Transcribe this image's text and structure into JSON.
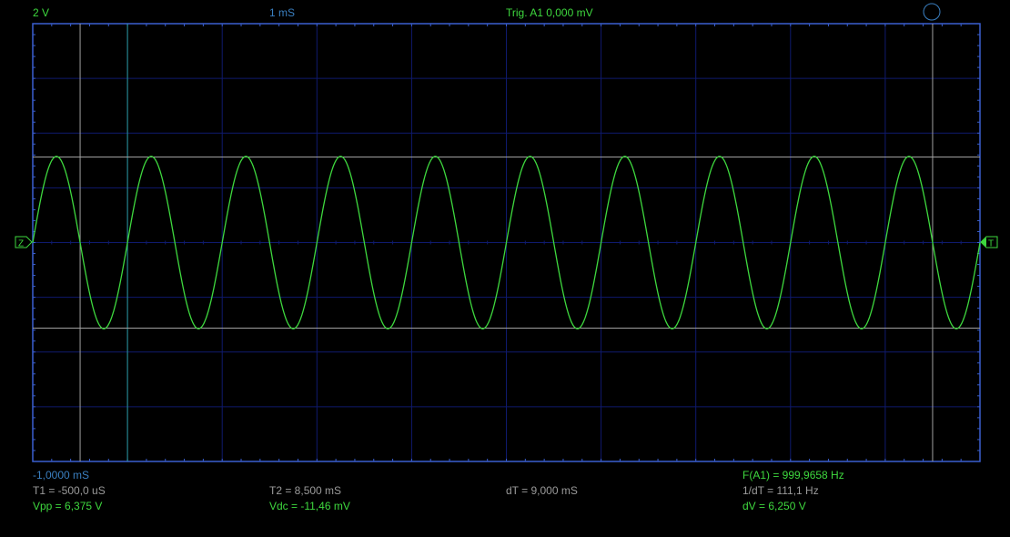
{
  "header": {
    "volts_per_div": "2 V",
    "time_per_div": "1 mS",
    "trigger": "Trig. A1  0,000 mV"
  },
  "markers": {
    "channel": "Z",
    "trigger": "T"
  },
  "readouts": {
    "offset_time": "-1,0000 mS",
    "t1": "T1 = -500,0 uS",
    "t2": "T2 = 8,500 mS",
    "dt": "dT = 9,000 mS",
    "vpp": "Vpp = 6,375 V",
    "vdc": "Vdc = -11,46 mV",
    "freq": "F(A1) = 999,9658 Hz",
    "inv_dt": "1/dT = 111,1 Hz",
    "dv": "dV = 6,250 V"
  },
  "scope": {
    "h_divs": 10,
    "v_divs": 8,
    "time_per_div_ms": 1,
    "volts_per_div": 2,
    "start_time_ms": -1.0,
    "signal_freq_hz": 999.9658,
    "signal_amplitude_v": 3.15,
    "cursor_t1_ms": -0.5,
    "cursor_t2_ms": 8.5,
    "trigger_pos_ms": 0,
    "cursor_v_top": 3.125,
    "cursor_v_bottom": -3.125
  },
  "colors": {
    "trace": "#3ed83e",
    "border": "#3a5fd0",
    "grid": "#0f1a6e",
    "cursor": "#a0a0a0",
    "trigger_line": "#2a9a9a"
  }
}
